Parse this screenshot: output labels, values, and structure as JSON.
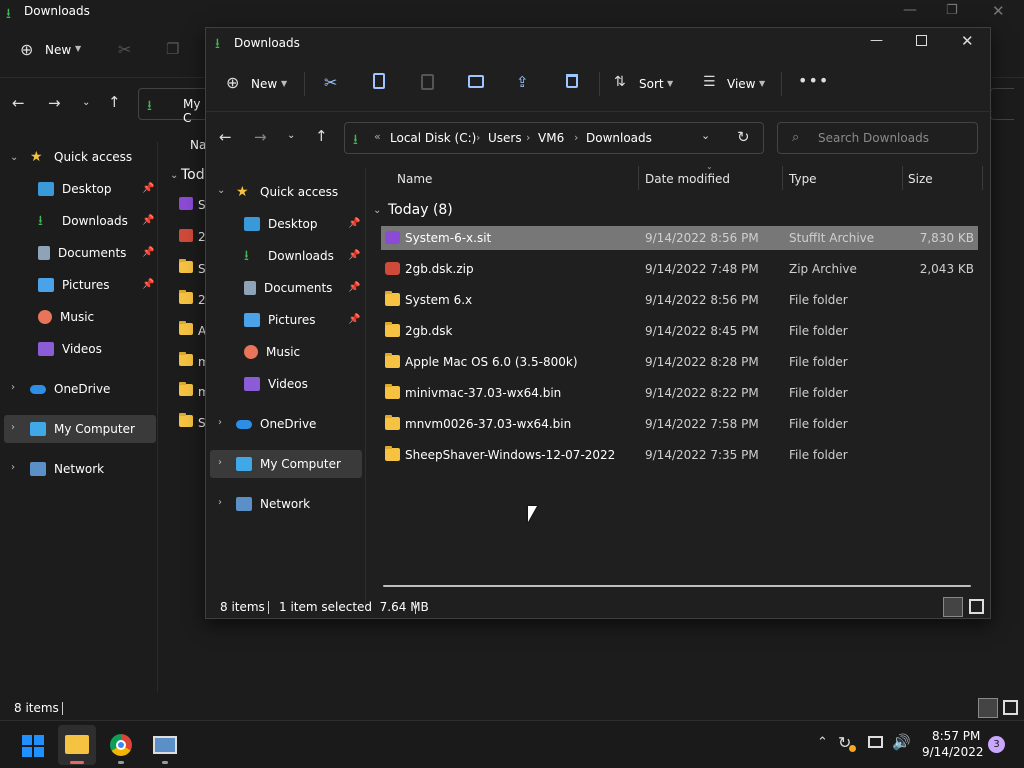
{
  "bg": {
    "title": "Downloads",
    "new_label": "New",
    "addr_partial": "My C",
    "col_partial": "Na",
    "group_partial": "Tod",
    "row_prefixes": [
      "Sy",
      "2g",
      "Sy",
      "2g",
      "A",
      "m",
      "m",
      "Sh"
    ],
    "sidebar": [
      {
        "label": "Quick access"
      },
      {
        "label": "Desktop"
      },
      {
        "label": "Downloads"
      },
      {
        "label": "Documents"
      },
      {
        "label": "Pictures"
      },
      {
        "label": "Music"
      },
      {
        "label": "Videos"
      },
      {
        "label": "OneDrive"
      },
      {
        "label": "My Computer"
      },
      {
        "label": "Network"
      }
    ],
    "status": "8 items"
  },
  "window": {
    "title": "Downloads",
    "toolbar": {
      "new": "New",
      "sort": "Sort",
      "view": "View"
    },
    "breadcrumb": [
      "Local Disk (C:)",
      "Users",
      "VM6",
      "Downloads"
    ],
    "search_placeholder": "Search Downloads",
    "sidebar": [
      {
        "label": "Quick access"
      },
      {
        "label": "Desktop"
      },
      {
        "label": "Downloads"
      },
      {
        "label": "Documents"
      },
      {
        "label": "Pictures"
      },
      {
        "label": "Music"
      },
      {
        "label": "Videos"
      },
      {
        "label": "OneDrive"
      },
      {
        "label": "My Computer"
      },
      {
        "label": "Network"
      }
    ],
    "columns": {
      "name": "Name",
      "date": "Date modified",
      "type": "Type",
      "size": "Size"
    },
    "group": "Today (8)",
    "files": [
      {
        "name": "System-6-x.sit",
        "date": "9/14/2022 8:56 PM",
        "type": "StuffIt Archive",
        "size": "7,830 KB",
        "icon": "sit-archive-icon",
        "selected": true
      },
      {
        "name": "2gb.dsk.zip",
        "date": "9/14/2022 7:48 PM",
        "type": "Zip Archive",
        "size": "2,043 KB",
        "icon": "zip-archive-icon"
      },
      {
        "name": "System 6.x",
        "date": "9/14/2022 8:56 PM",
        "type": "File folder",
        "size": "",
        "icon": "folder-icon"
      },
      {
        "name": "2gb.dsk",
        "date": "9/14/2022 8:45 PM",
        "type": "File folder",
        "size": "",
        "icon": "folder-icon"
      },
      {
        "name": "Apple Mac OS 6.0 (3.5-800k)",
        "date": "9/14/2022 8:28 PM",
        "type": "File folder",
        "size": "",
        "icon": "folder-icon"
      },
      {
        "name": "minivmac-37.03-wx64.bin",
        "date": "9/14/2022 8:22 PM",
        "type": "File folder",
        "size": "",
        "icon": "folder-icon"
      },
      {
        "name": "mnvm0026-37.03-wx64.bin",
        "date": "9/14/2022 7:58 PM",
        "type": "File folder",
        "size": "",
        "icon": "folder-icon"
      },
      {
        "name": "SheepShaver-Windows-12-07-2022",
        "date": "9/14/2022 7:35 PM",
        "type": "File folder",
        "size": "",
        "icon": "folder-icon"
      }
    ],
    "status": {
      "items": "8 items",
      "selected": "1 item selected  7.64 MB"
    }
  },
  "taskbar": {
    "time": "8:57 PM",
    "date": "9/14/2022",
    "badge": "3"
  }
}
